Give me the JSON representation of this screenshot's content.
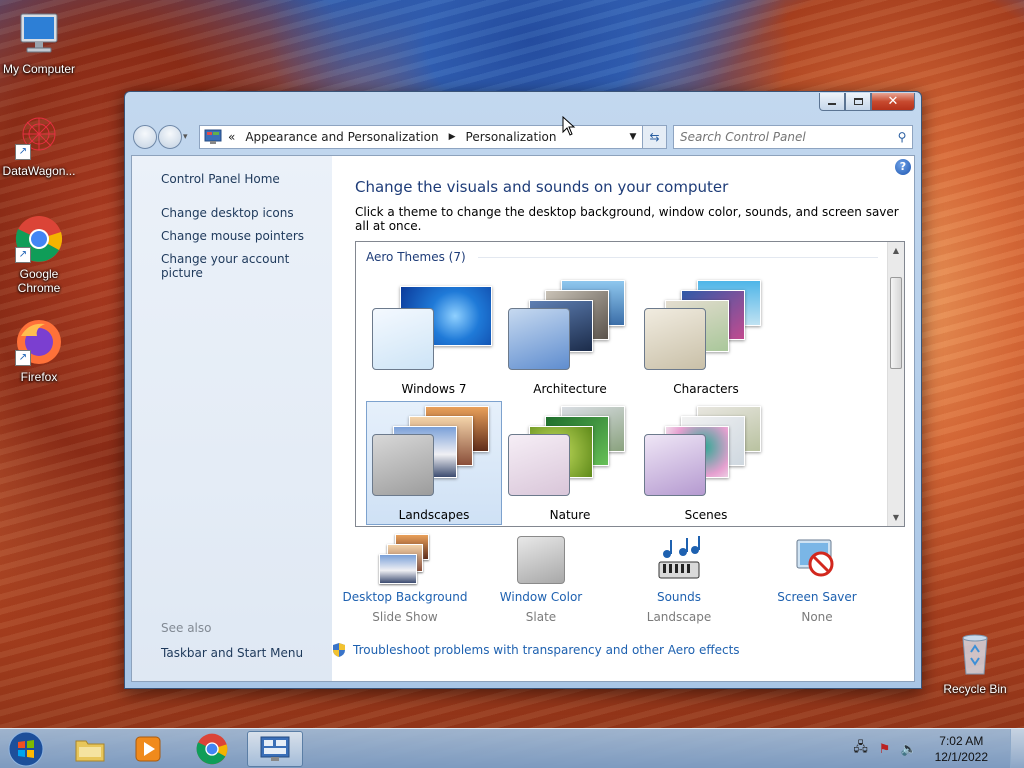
{
  "desktop": {
    "icons": [
      {
        "label": "My Computer"
      },
      {
        "label": "DataWagon..."
      },
      {
        "label": "Google Chrome"
      },
      {
        "label": "Firefox"
      },
      {
        "label": "Recycle Bin"
      }
    ]
  },
  "window": {
    "address": {
      "chevron": "«",
      "segments": [
        "Appearance and Personalization",
        "Personalization"
      ]
    },
    "search": {
      "placeholder": "Search Control Panel"
    },
    "leftpane": {
      "home": "Control Panel Home",
      "links": [
        "Change desktop icons",
        "Change mouse pointers",
        "Change your account picture"
      ],
      "see_also_label": "See also",
      "see_also_links": [
        "Taskbar and Start Menu"
      ]
    },
    "main": {
      "title": "Change the visuals and sounds on your computer",
      "subtitle": "Click a theme to change the desktop background, window color, sounds, and screen saver all at once.",
      "group_header": "Aero Themes (7)",
      "themes": [
        {
          "label": "Windows 7",
          "selected": false
        },
        {
          "label": "Architecture",
          "selected": false
        },
        {
          "label": "Characters",
          "selected": false
        },
        {
          "label": "Landscapes",
          "selected": true
        },
        {
          "label": "Nature",
          "selected": false
        },
        {
          "label": "Scenes",
          "selected": false
        }
      ],
      "settings": [
        {
          "label": "Desktop Background",
          "value": "Slide Show"
        },
        {
          "label": "Window Color",
          "value": "Slate"
        },
        {
          "label": "Sounds",
          "value": "Landscape"
        },
        {
          "label": "Screen Saver",
          "value": "None"
        }
      ],
      "troubleshoot": "Troubleshoot problems with transparency and other Aero effects"
    }
  },
  "taskbar": {
    "clock_time": "7:02 AM",
    "clock_date": "12/1/2022"
  },
  "colors": {
    "link": "#1e61b0",
    "title": "#1e3c78"
  }
}
